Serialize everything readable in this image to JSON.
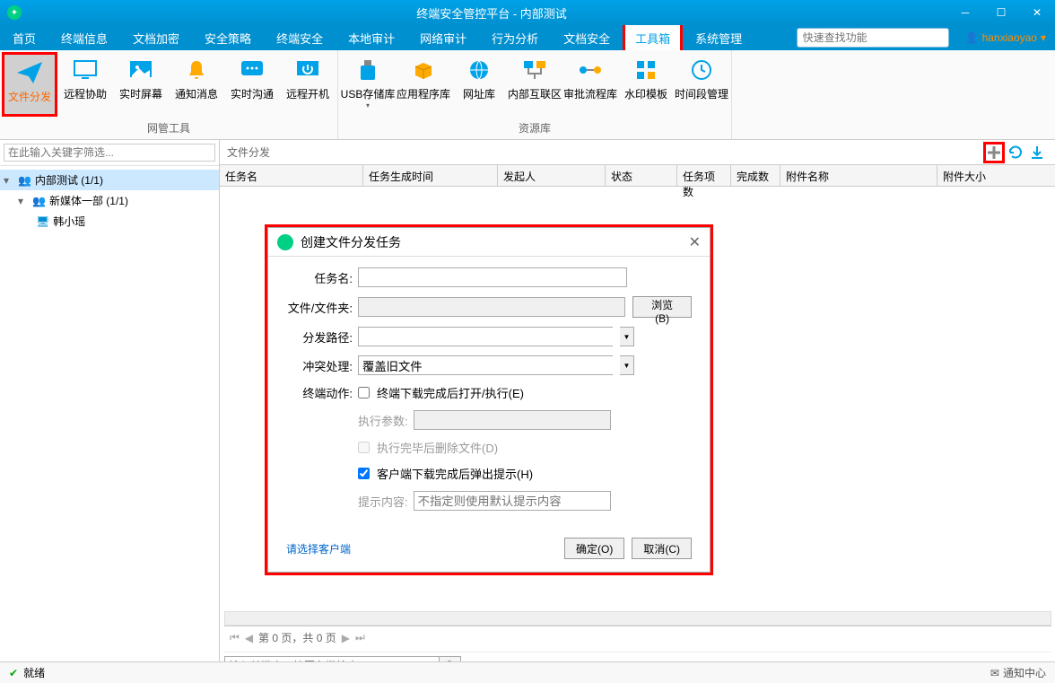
{
  "window": {
    "title": "终端安全管控平台 - 内部测试"
  },
  "menu": [
    "首页",
    "终端信息",
    "文档加密",
    "安全策略",
    "终端安全",
    "本地审计",
    "网络审计",
    "行为分析",
    "文档安全",
    "工具箱",
    "系统管理"
  ],
  "menu_active_index": 9,
  "search_placeholder": "快速查找功能",
  "user": "hanxiaoyao",
  "ribbon": {
    "group1": {
      "name": "网管工具",
      "items": [
        "文件分发",
        "远程协助",
        "实时屏幕",
        "通知消息",
        "实时沟通",
        "远程开机"
      ]
    },
    "group2": {
      "name": "资源库",
      "items": [
        "USB存储库",
        "应用程序库",
        "网址库",
        "内部互联区",
        "审批流程库",
        "水印模板",
        "时间段管理"
      ]
    }
  },
  "sidebar": {
    "placeholder": "在此输入关键字筛选...",
    "node1": "内部测试 (1/1)",
    "node2": "新媒体一部 (1/1)",
    "node3": "韩小瑶"
  },
  "main": {
    "title": "文件分发",
    "columns": [
      "任务名",
      "任务生成时间",
      "发起人",
      "状态",
      "任务项数",
      "完成数",
      "附件名称",
      "附件大小"
    ]
  },
  "dialog": {
    "title": "创建文件分发任务",
    "labels": {
      "taskname": "任务名:",
      "fileFolder": "文件/文件夹:",
      "path": "分发路径:",
      "conflict": "冲突处理:",
      "action": "终端动作:",
      "execParams": "执行参数:",
      "tipContent": "提示内容:"
    },
    "browse": "浏览(B)",
    "conflict_value": "覆盖旧文件",
    "cb_execute": "终端下载完成后打开/执行(E)",
    "cb_delete": "执行完毕后删除文件(D)",
    "cb_popup": "客户端下载完成后弹出提示(H)",
    "tip_placeholder": "不指定则使用默认提示内容",
    "select_client": "请选择客户端",
    "ok": "确定(O)",
    "cancel": "取消(C)"
  },
  "paging": "第 0 页，共 0 页",
  "bottom_search_placeholder": "输入关键字，按回车键检索...",
  "status": {
    "ready": "就绪",
    "notify": "通知中心"
  }
}
